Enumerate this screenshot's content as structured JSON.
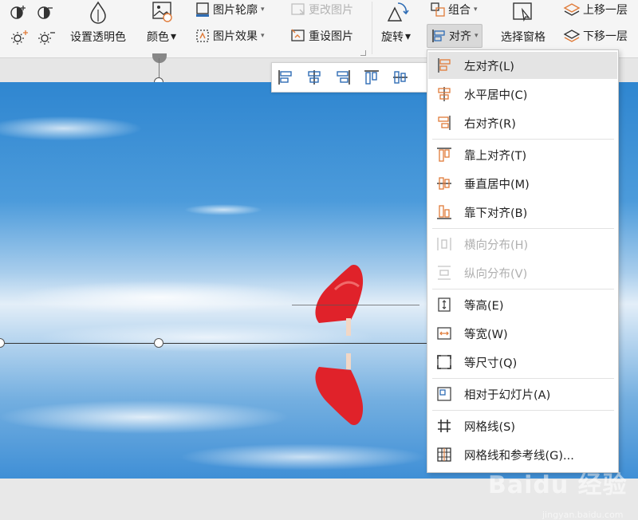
{
  "ribbon": {
    "transparent_label": "设置透明色",
    "color_label": "颜色",
    "outline_label": "图片轮廓",
    "effect_label": "图片效果",
    "change_label": "更改图片",
    "reset_label": "重设图片",
    "rotate_label": "旋转",
    "group_label": "组合",
    "align_label": "对齐",
    "selection_label": "选择窗格",
    "bring_forward_label": "上移一层",
    "send_backward_label": "下移一层"
  },
  "align_menu": {
    "items": [
      {
        "label": "左对齐(L)",
        "icon": "align-left-icon"
      },
      {
        "label": "水平居中(C)",
        "icon": "align-center-icon"
      },
      {
        "label": "右对齐(R)",
        "icon": "align-right-icon"
      },
      {
        "label": "靠上对齐(T)",
        "icon": "align-top-icon"
      },
      {
        "label": "垂直居中(M)",
        "icon": "align-middle-icon"
      },
      {
        "label": "靠下对齐(B)",
        "icon": "align-bottom-icon"
      },
      {
        "label": "横向分布(H)",
        "icon": "distribute-horizontal-icon"
      },
      {
        "label": "纵向分布(V)",
        "icon": "distribute-vertical-icon"
      },
      {
        "label": "等高(E)",
        "icon": "same-height-icon"
      },
      {
        "label": "等宽(W)",
        "icon": "same-width-icon"
      },
      {
        "label": "等尺寸(Q)",
        "icon": "same-size-icon"
      },
      {
        "label": "相对于幻灯片(A)",
        "icon": "relative-to-slide-icon"
      },
      {
        "label": "网格线(S)",
        "icon": "gridlines-icon"
      },
      {
        "label": "网格线和参考线(G)...",
        "icon": "gridlines-guides-icon"
      }
    ]
  },
  "watermark": {
    "text": "Baidu 经验",
    "sub": "jingyan.baidu.com"
  },
  "colors": {
    "accent_orange": "#e07b39",
    "accent_blue": "#2f6db5",
    "menu_highlight": "#e4e4e4"
  }
}
